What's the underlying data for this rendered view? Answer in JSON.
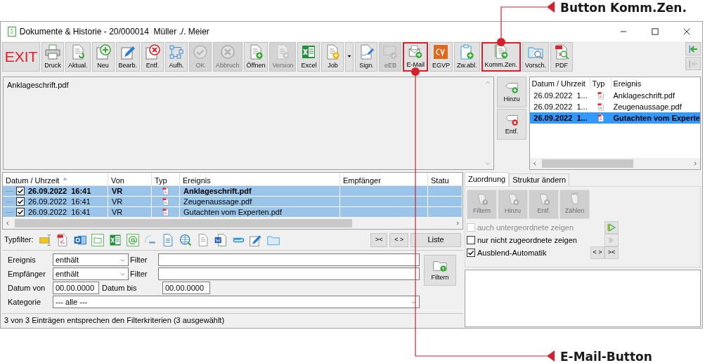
{
  "window": {
    "title": "Dokumente & Historie - 20/000014  Müller ./. Meier"
  },
  "toolbar": [
    {
      "kind": "exit",
      "label": "EXIT",
      "disabled": false,
      "highlighted": false
    },
    {
      "kind": "button",
      "label": "Druck",
      "disabled": false,
      "highlighted": false
    },
    {
      "kind": "button",
      "label": "Aktual.",
      "disabled": false,
      "highlighted": false
    },
    {
      "kind": "button",
      "label": "Neu",
      "disabled": false,
      "highlighted": false
    },
    {
      "kind": "button",
      "label": "Bearb.",
      "disabled": false,
      "highlighted": false
    },
    {
      "kind": "button",
      "label": "Entf.",
      "disabled": false,
      "highlighted": false
    },
    {
      "kind": "button",
      "label": "Aufh.",
      "disabled": false,
      "highlighted": false
    },
    {
      "kind": "button",
      "label": "OK",
      "disabled": true,
      "highlighted": false
    },
    {
      "kind": "button",
      "label": "Abbruch",
      "disabled": true,
      "highlighted": false
    },
    {
      "kind": "button",
      "label": "Öffnen",
      "disabled": false,
      "highlighted": false
    },
    {
      "kind": "button",
      "label": "Version",
      "disabled": true,
      "highlighted": false
    },
    {
      "kind": "button",
      "label": "Excel",
      "disabled": false,
      "highlighted": false
    },
    {
      "kind": "button",
      "label": "Job",
      "disabled": false,
      "highlighted": false
    },
    {
      "kind": "dropdown",
      "disabled": false,
      "highlighted": false
    },
    {
      "kind": "button",
      "label": "Sign.",
      "disabled": false,
      "highlighted": false
    },
    {
      "kind": "button",
      "label": "eEB",
      "disabled": true,
      "highlighted": false
    },
    {
      "kind": "button",
      "label": "E-Mail",
      "disabled": false,
      "highlighted": true,
      "callout": {
        "label": "E-Mail-Button",
        "kind": "below"
      }
    },
    {
      "kind": "button",
      "label": "EGVP",
      "disabled": false,
      "highlighted": false
    },
    {
      "kind": "button",
      "label": "Zw.abl.",
      "disabled": false,
      "highlighted": false
    },
    {
      "kind": "button",
      "label": "Komm.Zen.",
      "disabled": false,
      "highlighted": true,
      "callout": {
        "label": "Button Komm.Zen.",
        "kind": "above"
      }
    },
    {
      "kind": "button",
      "label": "Vorsch.",
      "disabled": false,
      "highlighted": false
    },
    {
      "kind": "button",
      "label": "PDF",
      "disabled": false,
      "highlighted": false
    }
  ],
  "preview": {
    "text": "Anklageschrift.pdf"
  },
  "attach_buttons": [
    {
      "label": "Hinzu"
    },
    {
      "label": "Entf."
    }
  ],
  "attachments": {
    "columns": [
      {
        "label": "Datum / Uhrzeit"
      },
      {
        "label": "Typ"
      },
      {
        "label": "Ereignis"
      }
    ],
    "rows": [
      {
        "datum": "26.09.2022  1...",
        "ereignis": "Anklageschrift.pdf",
        "selected": false
      },
      {
        "datum": "26.09.2022  1...",
        "ereignis": "Zeugenaussage.pdf",
        "selected": false
      },
      {
        "datum": "26.09.2022  1...",
        "ereignis": "Gutachten vom Experte",
        "selected": true
      }
    ]
  },
  "table": {
    "columns": [
      {
        "label": "Datum / Uhrzeit",
        "sorted": true
      },
      {
        "label": "Von",
        "sorted": false
      },
      {
        "label": "Typ",
        "sorted": false
      },
      {
        "label": "Ereignis",
        "sorted": false
      },
      {
        "label": "Empfänger",
        "sorted": false
      },
      {
        "label": "Statu",
        "sorted": false
      }
    ],
    "rows": [
      {
        "datum": "26.09.2022  16:41",
        "von": "VR",
        "ereignis": "Anklageschrift.pdf",
        "checked": true,
        "selected": true,
        "current": true
      },
      {
        "datum": "26.09.2022  16:41",
        "von": "VR",
        "ereignis": "Zeugenaussage.pdf",
        "checked": true,
        "selected": true,
        "current": false
      },
      {
        "datum": "26.09.2022  16:41",
        "von": "VR",
        "ereignis": "Gutachten vom Experten.pdf",
        "checked": true,
        "selected": true,
        "current": false
      }
    ]
  },
  "typfilter": {
    "label": "Typfilter:",
    "buttons": [
      {
        "label": "><"
      },
      {
        "label": "< >"
      },
      {
        "label": "Liste"
      }
    ]
  },
  "filter": {
    "ereignis": {
      "label": "Ereignis",
      "mode": "enthält",
      "filter_label": "Filter"
    },
    "empfaenger": {
      "label": "Empfänger",
      "mode": "enthält",
      "filter_label": "Filter"
    },
    "datum_von": {
      "label": "Datum von",
      "value": "00.00.0000"
    },
    "datum_bis": {
      "label": "Datum bis",
      "value": "00.00.0000"
    },
    "kategorie": {
      "label": "Kategorie",
      "value": "--- alle ---"
    },
    "button": {
      "label": "Filtern"
    }
  },
  "status_bar": "3 von 3 Einträgen entsprechen den Filterkriterien (3 ausgewählt)",
  "side_tabs": [
    {
      "label": "Zuordnung",
      "selected": true
    },
    {
      "label": "Struktur ändern",
      "selected": false
    }
  ],
  "side_buttons": [
    {
      "label": "Filtern",
      "disabled": true
    },
    {
      "label": "Hinzu",
      "disabled": true
    },
    {
      "label": "Entf.",
      "disabled": true
    },
    {
      "label": "Zählen",
      "disabled": true
    }
  ],
  "side_options": [
    {
      "label": "auch untergeordnete zeigen",
      "checked": false,
      "disabled": true
    },
    {
      "label": "nur nicht zugeordnete zeigen",
      "checked": false,
      "disabled": false
    },
    {
      "label": "Ausblend-Automatik",
      "checked": true,
      "disabled": false
    }
  ],
  "side_nav": [
    {
      "kind": "play",
      "disabled": false
    },
    {
      "kind": "play",
      "disabled": true
    },
    {
      "kind": "text",
      "label": "< >",
      "disabled": false
    },
    {
      "kind": "text",
      "label": "><",
      "disabled": false
    }
  ]
}
